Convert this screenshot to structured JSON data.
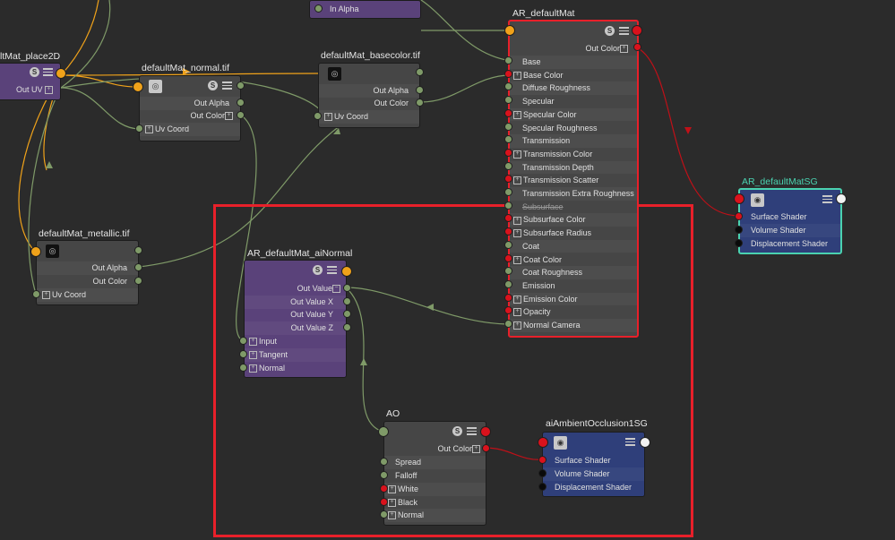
{
  "nodes": {
    "place2d": {
      "title": "ltMat_place2D",
      "out_uv": "Out UV"
    },
    "in_alpha": {
      "label": "In Alpha"
    },
    "normal_tif": {
      "title": "defaultMat_normal.tif",
      "out_alpha": "Out Alpha",
      "out_color": "Out Color",
      "uv_coord": "Uv Coord"
    },
    "basecolor_tif": {
      "title": "defaultMat_basecolor.tif",
      "out_alpha": "Out Alpha",
      "out_color": "Out Color",
      "uv_coord": "Uv Coord"
    },
    "metallic_tif": {
      "title": "defaultMat_metallic.tif",
      "out_alpha": "Out Alpha",
      "out_color": "Out Color",
      "uv_coord": "Uv Coord"
    },
    "default_mat": {
      "title": "AR_defaultMat",
      "out_color": "Out Color",
      "attributes": [
        "Base",
        "Base Color",
        "Diffuse Roughness",
        "Specular",
        "Specular Color",
        "Specular Roughness",
        "Transmission",
        "Transmission Color",
        "Transmission Depth",
        "Transmission Scatter",
        "Transmission Extra Roughness",
        "Subsurface",
        "Subsurface Color",
        "Subsurface Radius",
        "Coat",
        "Coat Color",
        "Coat Roughness",
        "Emission",
        "Emission Color",
        "Opacity",
        "Normal Camera"
      ]
    },
    "default_mat_sg": {
      "title": "AR_defaultMatSG",
      "rows": [
        "Surface Shader",
        "Volume Shader",
        "Displacement Shader"
      ]
    },
    "ai_normal": {
      "title": "AR_defaultMat_aiNormal",
      "outputs": [
        "Out Value",
        "Out Value X",
        "Out Value Y",
        "Out Value Z"
      ],
      "inputs": [
        "Input",
        "Tangent",
        "Normal"
      ]
    },
    "ao": {
      "title": "AO",
      "out_color": "Out Color",
      "inputs": [
        "Spread",
        "Falloff",
        "White",
        "Black",
        "Normal"
      ]
    },
    "ao_sg": {
      "title": "aiAmbientOcclusion1SG",
      "rows": [
        "Surface Shader",
        "Volume Shader",
        "Displacement Shader"
      ]
    }
  },
  "icons": {
    "s": "S"
  },
  "colors": {
    "selection_red": "#e8202a",
    "sg_teal": "#4ad2b0",
    "wire_green": "#7f9a68",
    "wire_orange": "#f0a21a",
    "wire_red": "#c01018"
  }
}
